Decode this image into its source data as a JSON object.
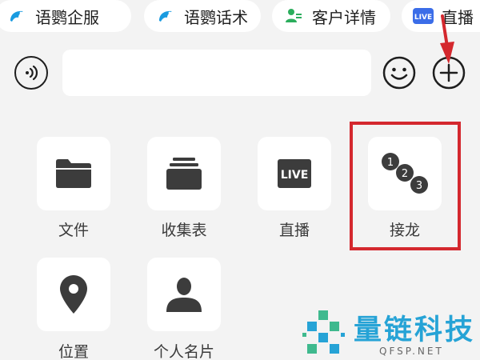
{
  "shortcuts": [
    {
      "label": "语鹦企服",
      "icon": "parrot-logo-icon",
      "color": "#1a9be0"
    },
    {
      "label": "语鹦话术",
      "icon": "parrot-logo-icon",
      "color": "#1a9be0"
    },
    {
      "label": "客户详情",
      "icon": "customer-card-icon",
      "color": "#2bad5c"
    },
    {
      "label": "直播",
      "icon": "live-badge-icon",
      "color": "#3b6de8",
      "icon_text": "LIVE"
    }
  ],
  "input": {
    "placeholder": "",
    "value": ""
  },
  "functions": [
    {
      "label": "文件",
      "icon": "folder-icon"
    },
    {
      "label": "收集表",
      "icon": "collection-form-icon"
    },
    {
      "label": "直播",
      "icon": "live-icon",
      "icon_text": "LIVE"
    },
    {
      "label": "接龙",
      "icon": "relay-icon",
      "icon_text": [
        "1",
        "2",
        "3"
      ]
    },
    {
      "label": "位置",
      "icon": "location-pin-icon"
    },
    {
      "label": "个人名片",
      "icon": "person-card-icon"
    }
  ],
  "annotation": {
    "color": "#d4282e"
  },
  "watermark": {
    "name": "量链科技",
    "url": "QFSP.NET"
  }
}
